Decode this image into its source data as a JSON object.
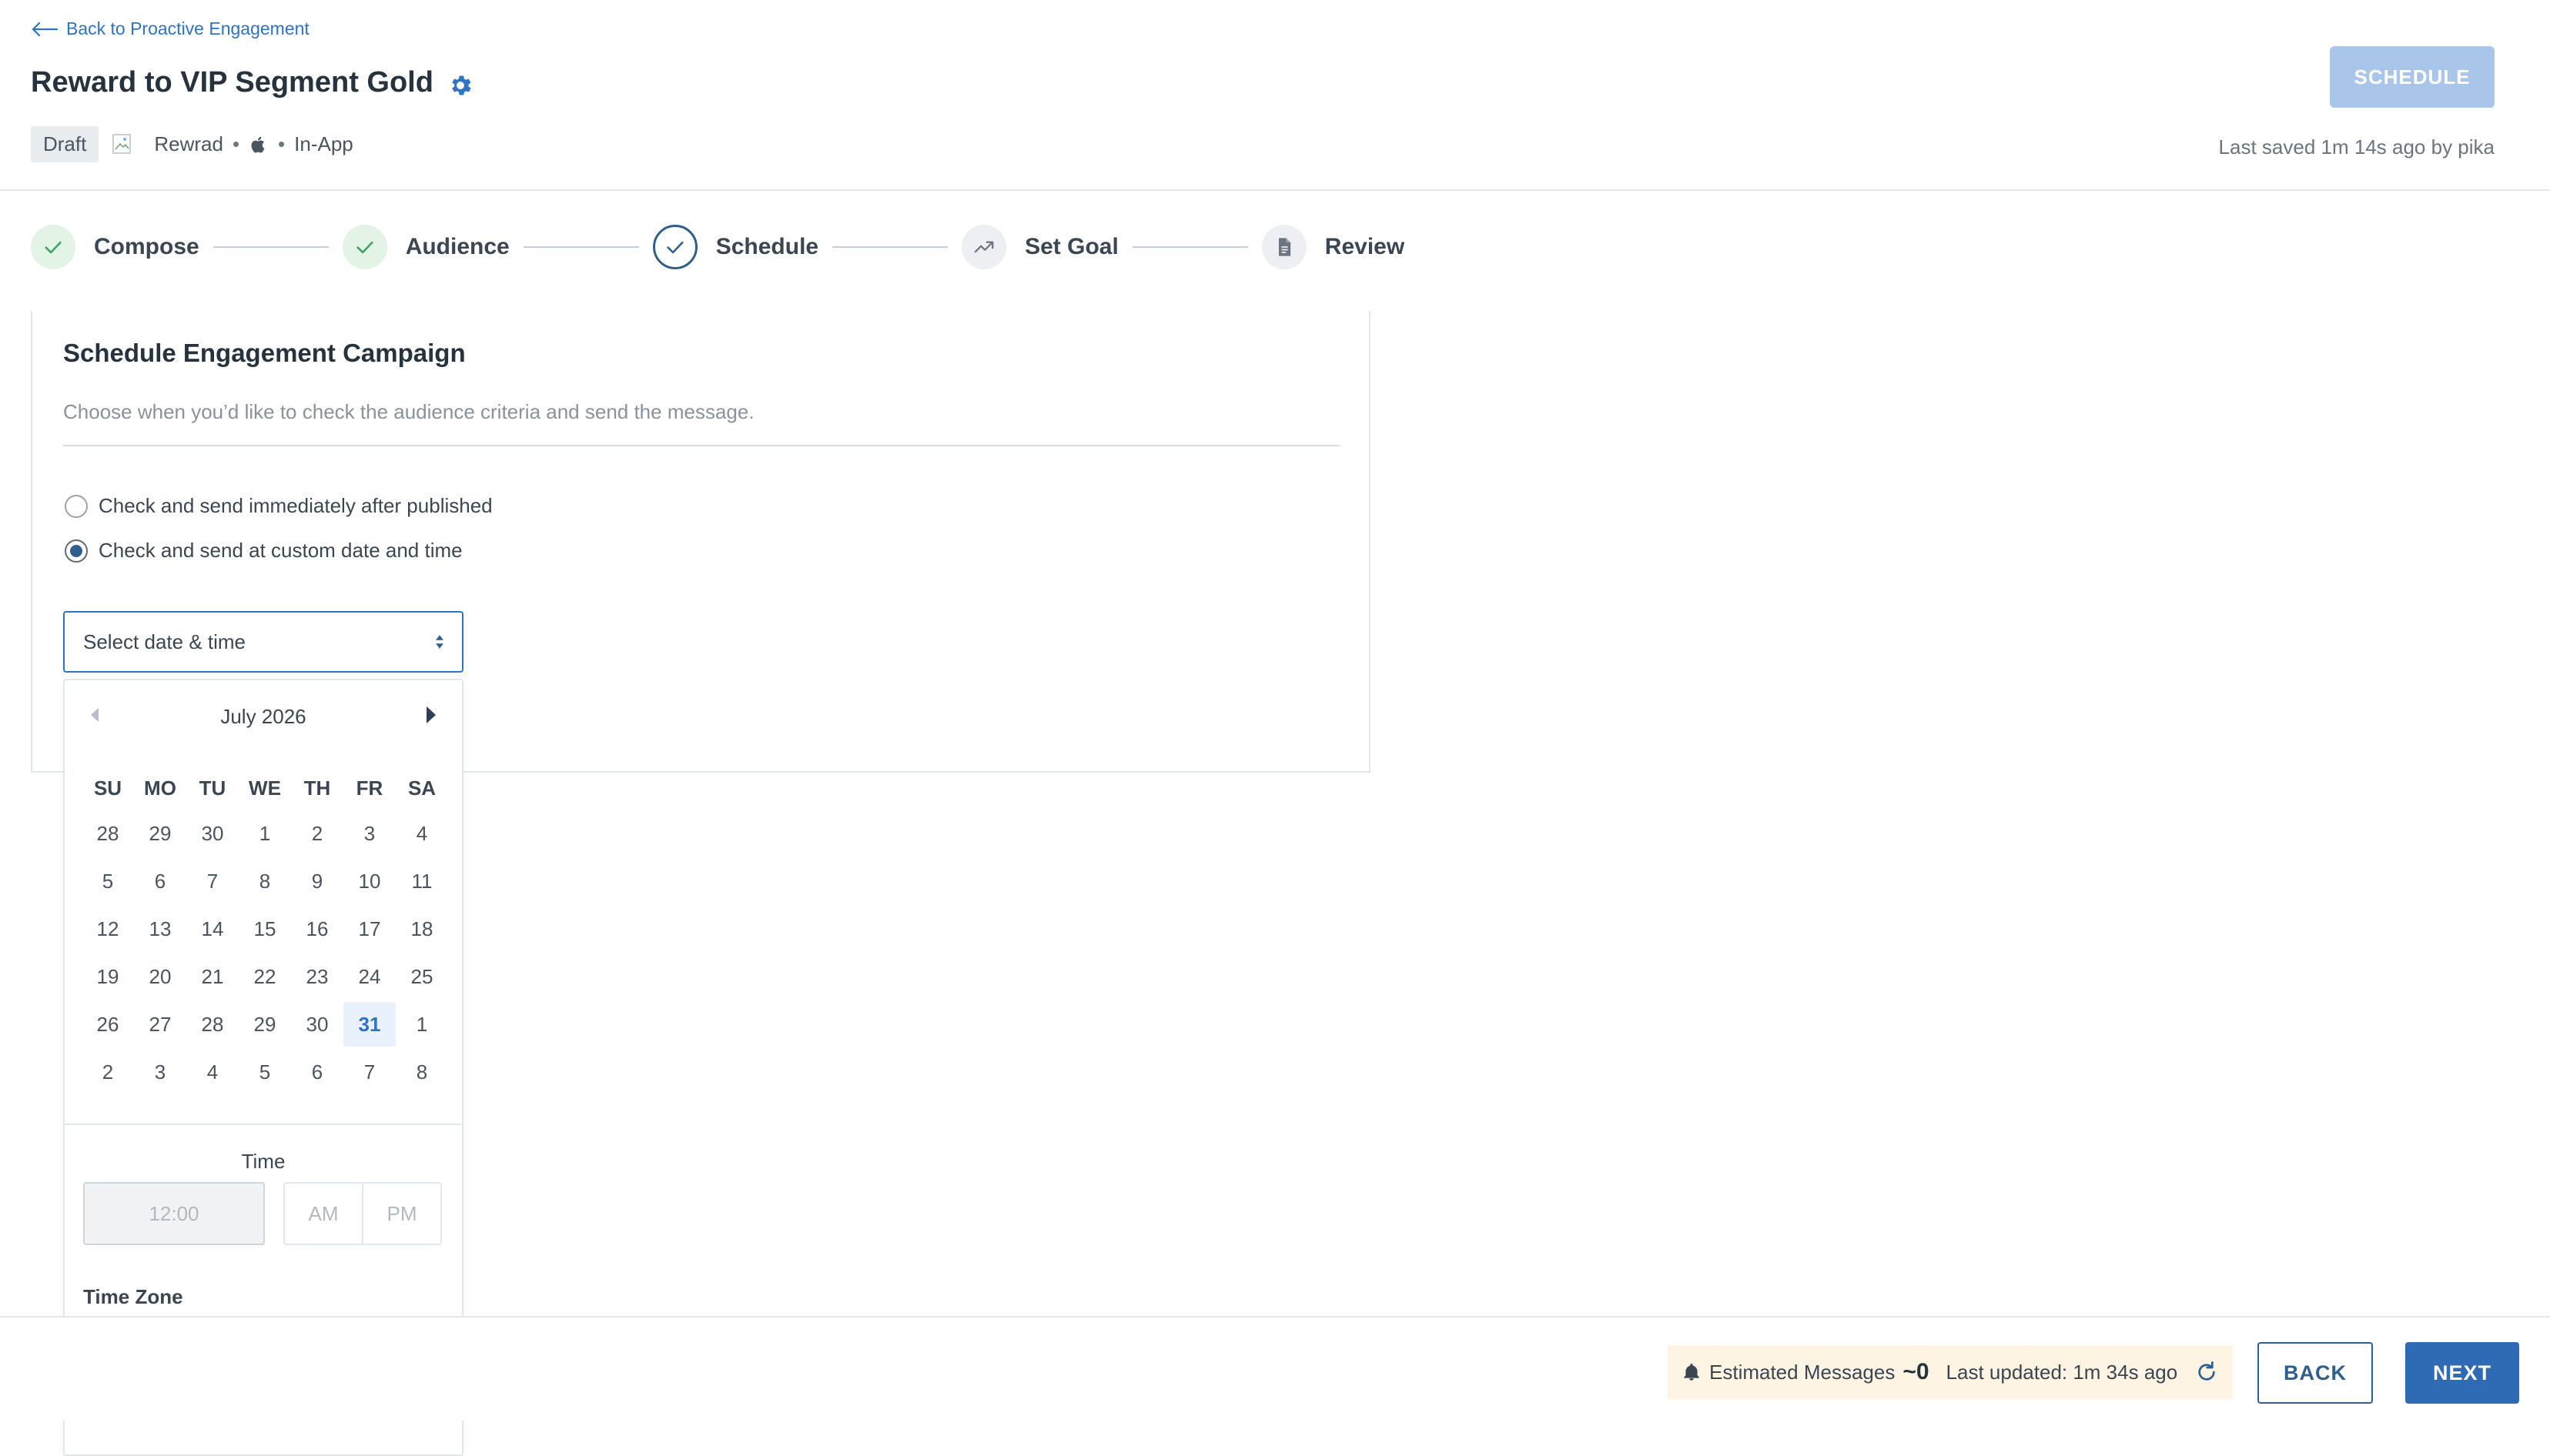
{
  "header": {
    "back_link": "Back to Proactive Engagement",
    "title": "Reward to VIP Segment Gold",
    "status": "Draft",
    "reward_name": "Rewrad",
    "channel": "In-App",
    "schedule_button": "SCHEDULE",
    "last_saved": "Last saved 1m 14s ago by pika"
  },
  "stepper": [
    {
      "label": "Compose",
      "state": "done"
    },
    {
      "label": "Audience",
      "state": "done"
    },
    {
      "label": "Schedule",
      "state": "active"
    },
    {
      "label": "Set Goal",
      "state": "todo"
    },
    {
      "label": "Review",
      "state": "todo"
    }
  ],
  "schedule": {
    "title": "Schedule Engagement Campaign",
    "subtitle": "Choose when you’d like to check the audience criteria and send the message.",
    "options": [
      {
        "label": "Check and send immediately after published",
        "checked": false
      },
      {
        "label": "Check and send at custom date and time",
        "checked": true
      }
    ],
    "select_placeholder": "Select date & time"
  },
  "calendar": {
    "month_label": "July 2026",
    "weekdays": [
      "SU",
      "MO",
      "TU",
      "WE",
      "TH",
      "FR",
      "SA"
    ],
    "weeks": [
      [
        "28",
        "29",
        "30",
        "1",
        "2",
        "3",
        "4"
      ],
      [
        "5",
        "6",
        "7",
        "8",
        "9",
        "10",
        "11"
      ],
      [
        "12",
        "13",
        "14",
        "15",
        "16",
        "17",
        "18"
      ],
      [
        "19",
        "20",
        "21",
        "22",
        "23",
        "24",
        "25"
      ],
      [
        "26",
        "27",
        "28",
        "29",
        "30",
        "31",
        "1"
      ],
      [
        "2",
        "3",
        "4",
        "5",
        "6",
        "7",
        "8"
      ]
    ],
    "selected_day": "31",
    "time_label": "Time",
    "time_placeholder": "12:00",
    "am": "AM",
    "pm": "PM",
    "timezone_label": "Time Zone"
  },
  "footer": {
    "estimated_label": "Estimated Messages",
    "estimated_value": "~0",
    "last_updated": "Last updated: 1m 34s ago",
    "back_button": "BACK",
    "next_button": "NEXT"
  },
  "colors": {
    "accent": "#2f73c4",
    "primary_button": "#2f6ab4",
    "disabled_button": "#a9c5ea",
    "success_bg": "#e3f3e5",
    "success_check": "#3da35d",
    "estimate_bg": "#fdf4e3"
  }
}
